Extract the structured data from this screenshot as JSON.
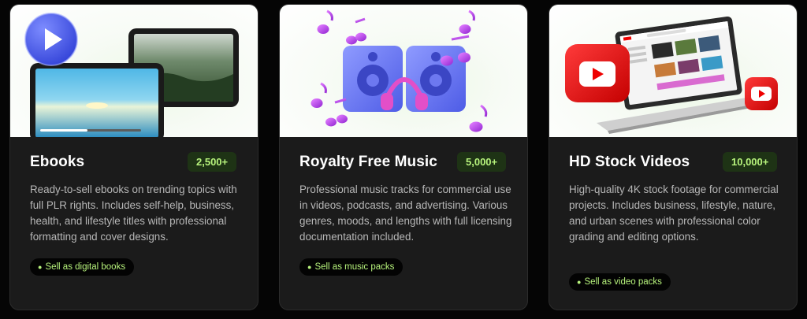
{
  "cards": [
    {
      "title": "Ebooks",
      "count": "2,500+",
      "description": "Ready-to-sell ebooks on trending topics with full PLR rights. Includes self-help, business, health, and lifestyle titles with professional formatting and cover designs.",
      "tag": "Sell as digital books",
      "illustration": "tablet-video-player-icon"
    },
    {
      "title": "Royalty Free Music",
      "count": "5,000+",
      "description": "Professional music tracks for commercial use in videos, podcasts, and advertising. Various genres, moods, and lengths with full licensing documentation included.",
      "tag": "Sell as music packs",
      "illustration": "speakers-headphones-icon"
    },
    {
      "title": "HD Stock Videos",
      "count": "10,000+",
      "description": "High-quality 4K stock footage for commercial projects. Includes business, lifestyle, nature, and urban scenes with professional color grading and editing options.",
      "tag": "Sell as video packs",
      "illustration": "laptop-youtube-icon"
    }
  ],
  "colors": {
    "accent": "#b7f37c",
    "card_bg": "#1b1b1b",
    "page_bg": "#050505",
    "badge_bg": "#1e3315"
  }
}
